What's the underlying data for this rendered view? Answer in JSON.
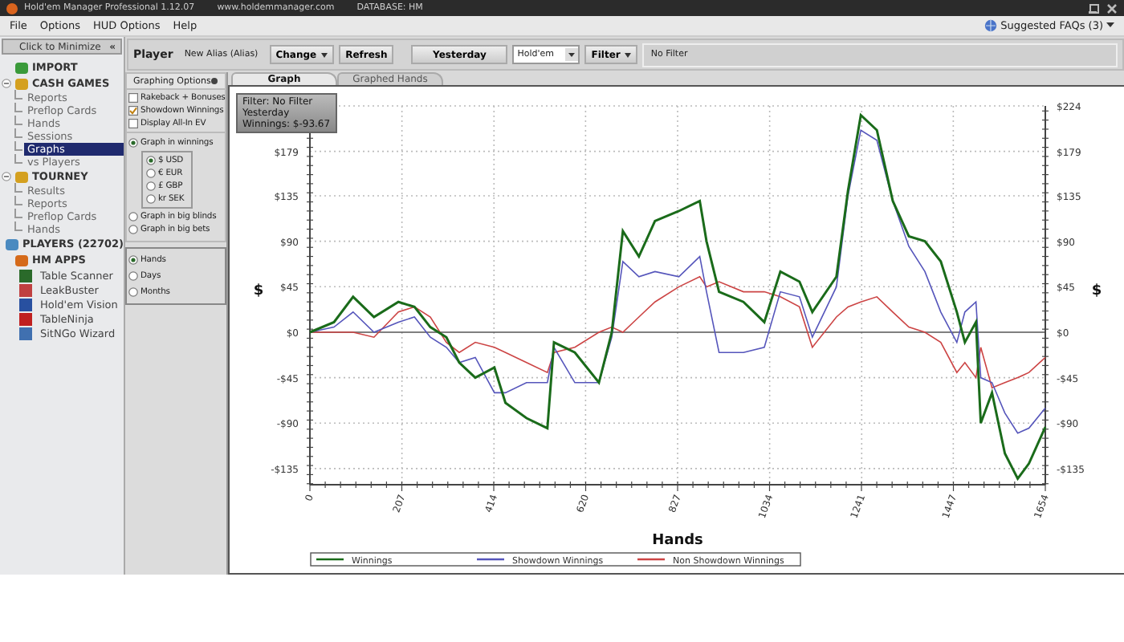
{
  "window": {
    "title": "Hold'em Manager Professional 1.12.07",
    "website": "www.holdemmanager.com",
    "database": "DATABASE: HM"
  },
  "menu": [
    {
      "label": "File"
    },
    {
      "label": "Options"
    },
    {
      "label": "HUD Options"
    },
    {
      "label": "Help"
    }
  ],
  "faq": {
    "label": "Suggested FAQs (3)"
  },
  "sidebar": {
    "minimize": {
      "label": "Click to Minimize",
      "glyph": "«"
    },
    "sections": [
      {
        "label": "IMPORT",
        "kind": "import"
      },
      {
        "label": "CASH GAMES",
        "kind": "cash",
        "expanded": true,
        "children": [
          {
            "label": "Reports",
            "selected": false
          },
          {
            "label": "Preflop Cards",
            "selected": false
          },
          {
            "label": "Hands",
            "selected": false
          },
          {
            "label": "Sessions",
            "selected": false
          },
          {
            "label": "Graphs",
            "selected": true
          },
          {
            "label": "vs Players",
            "selected": false
          }
        ]
      },
      {
        "label": "TOURNEY",
        "kind": "tourney",
        "expanded": true,
        "children": [
          {
            "label": "Results",
            "selected": false
          },
          {
            "label": "Reports",
            "selected": false
          },
          {
            "label": "Preflop Cards",
            "selected": false
          },
          {
            "label": "Hands",
            "selected": false
          }
        ]
      },
      {
        "label": "PLAYERS (22702)",
        "kind": "players"
      },
      {
        "label": "HM APPS",
        "kind": "apps",
        "children": [
          {
            "label": "Table Scanner",
            "selected": false
          },
          {
            "label": "LeakBuster",
            "selected": false
          },
          {
            "label": "Hold'em Vision",
            "selected": false
          },
          {
            "label": "TableNinja",
            "selected": false
          },
          {
            "label": "SitNGo Wizard",
            "selected": false
          }
        ]
      }
    ]
  },
  "toolbar": {
    "player_label": "Player",
    "alias": "New Alias (Alias)",
    "change": "Change",
    "refresh": "Refresh",
    "date": "Yesterday",
    "game": "Hold'em",
    "filter": "Filter",
    "filter_value": "No Filter"
  },
  "options": {
    "title": "Graphing Options",
    "checks": [
      {
        "label": "Rakeback + Bonuses",
        "checked": false
      },
      {
        "label": "Showdown Winnings",
        "checked": true
      },
      {
        "label": "Display All-In EV",
        "checked": false
      }
    ],
    "modes": [
      {
        "label": "Graph in winnings",
        "selected": true,
        "currencies": [
          {
            "label": "$ USD",
            "selected": true
          },
          {
            "label": "€ EUR",
            "selected": false
          },
          {
            "label": "£ GBP",
            "selected": false
          },
          {
            "label": "kr SEK",
            "selected": false
          }
        ]
      },
      {
        "label": "Graph in big blinds",
        "selected": false
      },
      {
        "label": "Graph in big bets",
        "selected": false
      }
    ],
    "periods": [
      {
        "label": "Hands",
        "selected": true
      },
      {
        "label": "Days",
        "selected": false
      },
      {
        "label": "Months",
        "selected": false
      }
    ]
  },
  "tabs": [
    {
      "label": "Graph",
      "selected": true
    },
    {
      "label": "Graphed Hands",
      "selected": false
    }
  ],
  "graph": {
    "info": [
      "Filter: No Filter",
      "Yesterday",
      "Winnings: $-93.67"
    ],
    "right_axis_label": "$",
    "chart_data": {
      "type": "line",
      "grid": true,
      "legend": true,
      "xlabel": "Hands",
      "ylabel": "$",
      "xlim": [
        0,
        1654
      ],
      "ylim": [
        -151,
        224
      ],
      "xticks": [
        0,
        207,
        414,
        620,
        827,
        1034,
        1241,
        1447,
        1654
      ],
      "yticks": [
        {
          "value": 224,
          "label": "$224"
        },
        {
          "value": 179,
          "label": "$179"
        },
        {
          "value": 135,
          "label": "$135"
        },
        {
          "value": 90,
          "label": "$90"
        },
        {
          "value": 45,
          "label": "$45"
        },
        {
          "value": 0,
          "label": "$0"
        },
        {
          "value": -45,
          "label": "-$45"
        },
        {
          "value": -90,
          "label": "-$90"
        },
        {
          "value": -135,
          "label": "-$135"
        }
      ],
      "x": [
        0,
        54,
        97,
        144,
        199,
        235,
        271,
        307,
        336,
        372,
        415,
        440,
        487,
        534,
        549,
        596,
        650,
        679,
        704,
        740,
        776,
        830,
        877,
        892,
        920,
        975,
        1022,
        1058,
        1101,
        1130,
        1184,
        1210,
        1239,
        1275,
        1311,
        1347,
        1383,
        1419,
        1455,
        1473,
        1498,
        1509,
        1534,
        1563,
        1592,
        1617,
        1654
      ],
      "series": [
        {
          "name": "Winnings",
          "color": "#1a6b1a",
          "values": [
            0,
            10,
            35,
            15,
            30,
            25,
            5,
            -5,
            -30,
            -45,
            -35,
            -70,
            -85,
            -95,
            -10,
            -20,
            -50,
            0,
            100,
            75,
            110,
            120,
            130,
            90,
            40,
            30,
            10,
            60,
            50,
            20,
            55,
            140,
            215,
            200,
            130,
            95,
            90,
            70,
            20,
            -10,
            10,
            -90,
            -60,
            -120,
            -145,
            -130,
            -94
          ]
        },
        {
          "name": "Showdown Winnings",
          "color": "#5555bb",
          "values": [
            0,
            5,
            20,
            0,
            10,
            15,
            -5,
            -15,
            -30,
            -25,
            -60,
            -60,
            -50,
            -50,
            -15,
            -50,
            -50,
            -5,
            70,
            55,
            60,
            55,
            75,
            40,
            -20,
            -20,
            -15,
            40,
            35,
            -5,
            45,
            135,
            200,
            190,
            130,
            85,
            60,
            20,
            -10,
            20,
            30,
            -45,
            -50,
            -80,
            -100,
            -95,
            -75
          ]
        },
        {
          "name": "Non Showdown Winnings",
          "color": "#cc4444",
          "values": [
            0,
            0,
            0,
            -5,
            20,
            25,
            15,
            -10,
            -20,
            -10,
            -15,
            -20,
            -30,
            -40,
            -20,
            -15,
            0,
            5,
            0,
            15,
            30,
            45,
            55,
            45,
            50,
            40,
            40,
            35,
            25,
            -15,
            15,
            25,
            30,
            35,
            20,
            5,
            0,
            -10,
            -40,
            -30,
            -45,
            -15,
            -55,
            -50,
            -45,
            -40,
            -25
          ]
        }
      ]
    }
  }
}
